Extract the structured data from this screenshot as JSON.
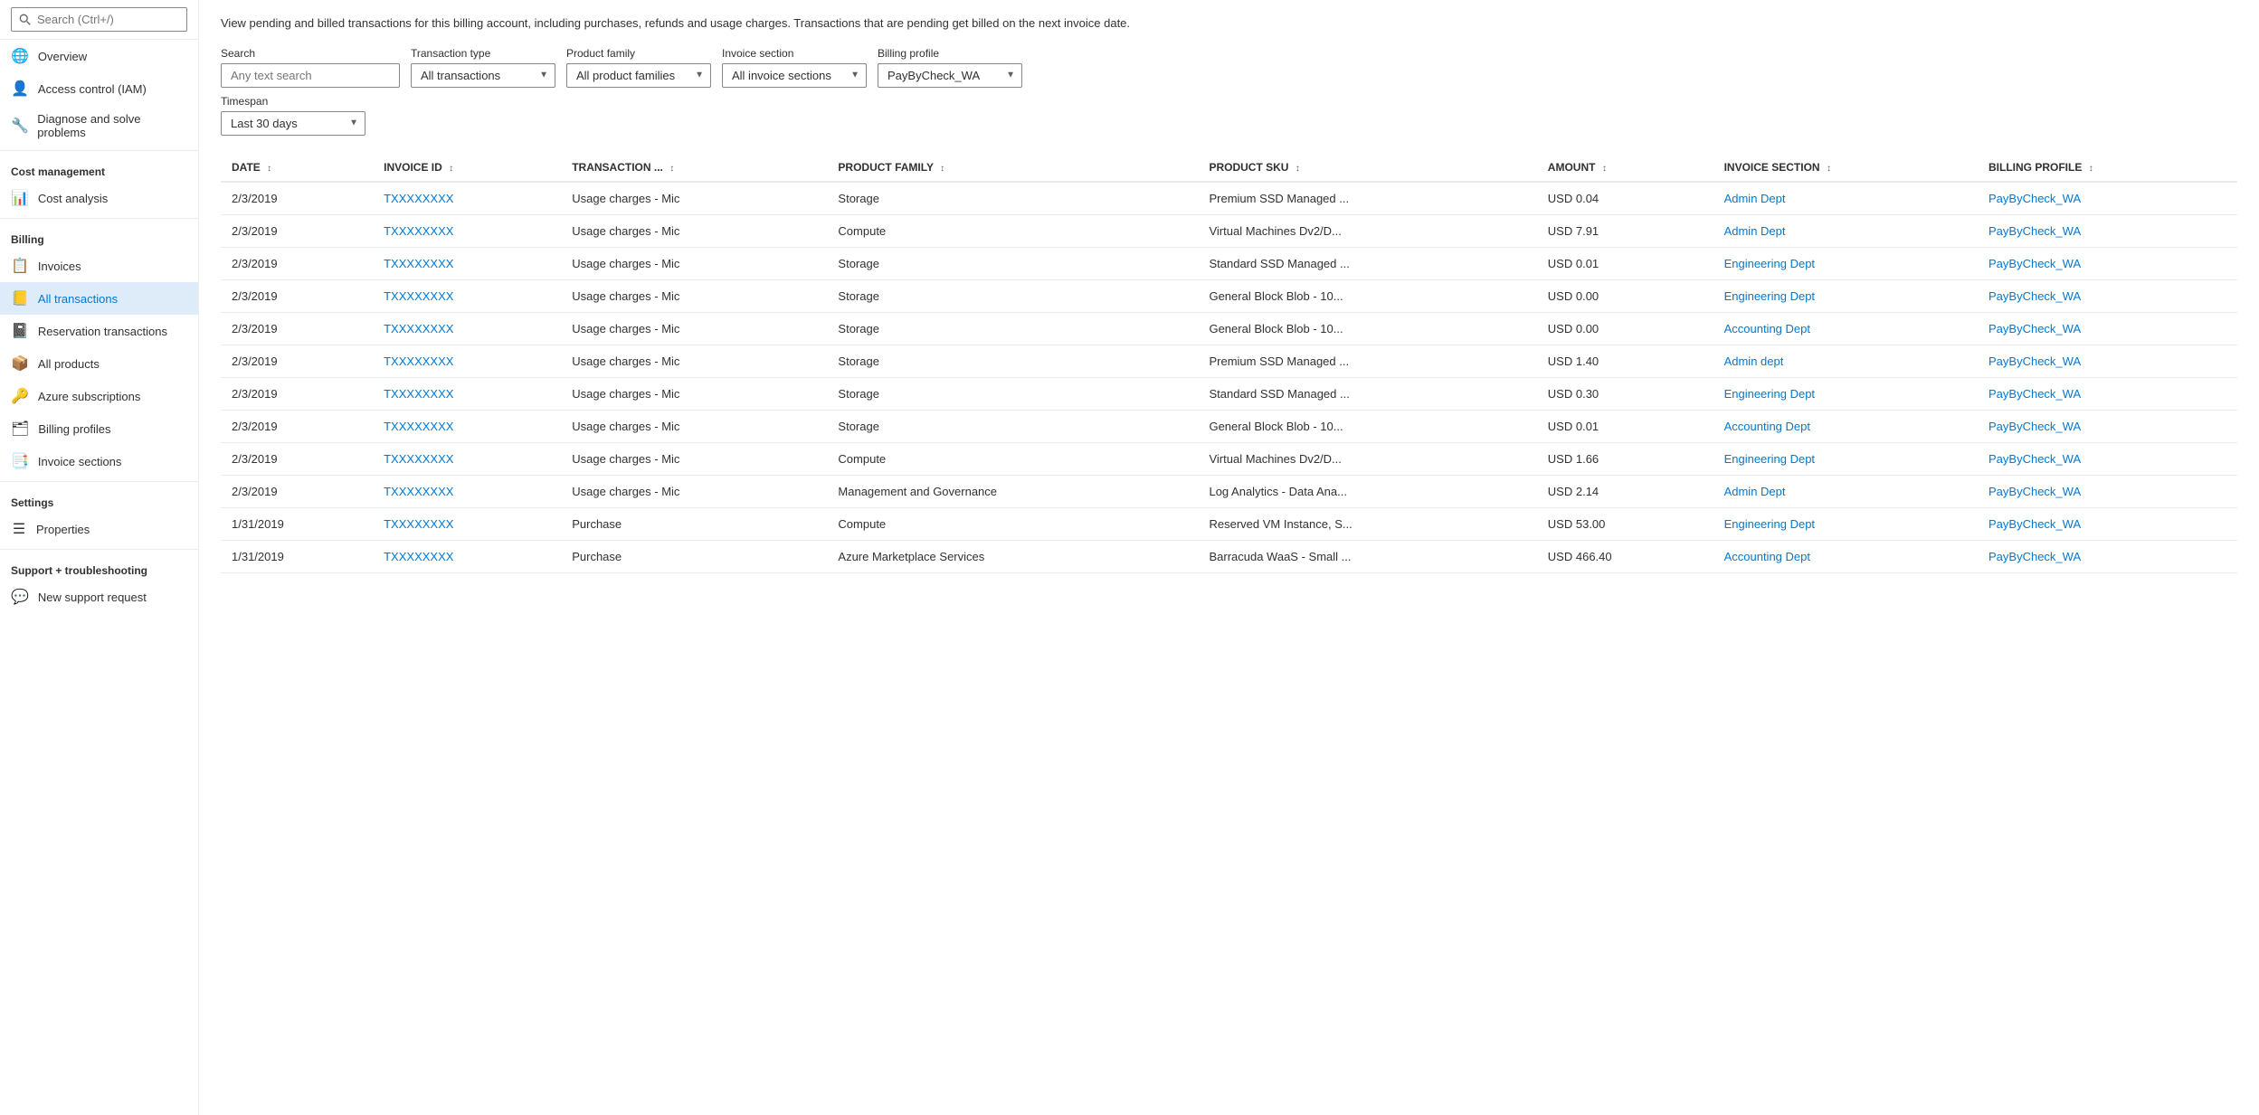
{
  "sidebar": {
    "search_placeholder": "Search (Ctrl+/)",
    "items": [
      {
        "id": "overview",
        "label": "Overview",
        "icon": "🌐",
        "section": null
      },
      {
        "id": "iam",
        "label": "Access control (IAM)",
        "icon": "👤",
        "section": null
      },
      {
        "id": "diagnose",
        "label": "Diagnose and solve problems",
        "icon": "🔧",
        "section": null
      },
      {
        "id": "cost-management-label",
        "label": "Cost management",
        "section_header": true
      },
      {
        "id": "cost-analysis",
        "label": "Cost analysis",
        "icon": "📊",
        "section": "cost-management"
      },
      {
        "id": "billing-label",
        "label": "Billing",
        "section_header": true
      },
      {
        "id": "invoices",
        "label": "Invoices",
        "icon": "📋",
        "section": "billing"
      },
      {
        "id": "all-transactions",
        "label": "All transactions",
        "icon": "📒",
        "section": "billing",
        "active": true
      },
      {
        "id": "reservation-transactions",
        "label": "Reservation transactions",
        "icon": "📓",
        "section": "billing"
      },
      {
        "id": "all-products",
        "label": "All products",
        "icon": "📦",
        "section": "billing"
      },
      {
        "id": "azure-subscriptions",
        "label": "Azure subscriptions",
        "icon": "🔑",
        "section": "billing"
      },
      {
        "id": "billing-profiles",
        "label": "Billing profiles",
        "icon": "🗂",
        "section": "billing"
      },
      {
        "id": "invoice-sections",
        "label": "Invoice sections",
        "icon": "📑",
        "section": "billing"
      },
      {
        "id": "settings-label",
        "label": "Settings",
        "section_header": true
      },
      {
        "id": "properties",
        "label": "Properties",
        "icon": "☰",
        "section": "settings"
      },
      {
        "id": "support-label",
        "label": "Support + troubleshooting",
        "section_header": true
      },
      {
        "id": "new-support-request",
        "label": "New support request",
        "icon": "💬",
        "section": "support"
      }
    ]
  },
  "page": {
    "description": "View pending and billed transactions for this billing account, including purchases, refunds and usage charges. Transactions that are pending get billed on the next invoice date."
  },
  "filters": {
    "search_label": "Search",
    "search_placeholder": "Any text search",
    "transaction_type_label": "Transaction type",
    "transaction_type_value": "All transactions",
    "product_family_label": "Product family",
    "product_family_value": "All product families",
    "invoice_section_label": "Invoice section",
    "invoice_section_value": "All invoice sections",
    "billing_profile_label": "Billing profile",
    "billing_profile_value": "PayByCheck_WA",
    "timespan_label": "Timespan",
    "timespan_value": "Last 30 days"
  },
  "table": {
    "columns": [
      {
        "id": "date",
        "label": "DATE"
      },
      {
        "id": "invoice-id",
        "label": "INVOICE ID"
      },
      {
        "id": "transaction",
        "label": "TRANSACTION ..."
      },
      {
        "id": "product-family",
        "label": "PRODUCT FAMILY"
      },
      {
        "id": "product-sku",
        "label": "PRODUCT SKU"
      },
      {
        "id": "amount",
        "label": "AMOUNT"
      },
      {
        "id": "invoice-section",
        "label": "INVOICE SECTION"
      },
      {
        "id": "billing-profile",
        "label": "BILLING PROFILE"
      }
    ],
    "rows": [
      {
        "date": "2/3/2019",
        "invoiceId": "TXXXXXXXX",
        "transaction": "Usage charges - Mic",
        "productFamily": "Storage",
        "productSku": "Premium SSD Managed ...",
        "amount": "USD 0.04",
        "invoiceSection": "Admin Dept",
        "billingProfile": "PayByCheck_WA"
      },
      {
        "date": "2/3/2019",
        "invoiceId": "TXXXXXXXX",
        "transaction": "Usage charges - Mic",
        "productFamily": "Compute",
        "productSku": "Virtual Machines Dv2/D...",
        "amount": "USD 7.91",
        "invoiceSection": "Admin Dept",
        "billingProfile": "PayByCheck_WA"
      },
      {
        "date": "2/3/2019",
        "invoiceId": "TXXXXXXXX",
        "transaction": "Usage charges - Mic",
        "productFamily": "Storage",
        "productSku": "Standard SSD Managed ...",
        "amount": "USD 0.01",
        "invoiceSection": "Engineering Dept",
        "billingProfile": "PayByCheck_WA"
      },
      {
        "date": "2/3/2019",
        "invoiceId": "TXXXXXXXX",
        "transaction": "Usage charges - Mic",
        "productFamily": "Storage",
        "productSku": "General Block Blob - 10...",
        "amount": "USD 0.00",
        "invoiceSection": "Engineering Dept",
        "billingProfile": "PayByCheck_WA"
      },
      {
        "date": "2/3/2019",
        "invoiceId": "TXXXXXXXX",
        "transaction": "Usage charges - Mic",
        "productFamily": "Storage",
        "productSku": "General Block Blob - 10...",
        "amount": "USD 0.00",
        "invoiceSection": "Accounting Dept",
        "billingProfile": "PayByCheck_WA"
      },
      {
        "date": "2/3/2019",
        "invoiceId": "TXXXXXXXX",
        "transaction": "Usage charges - Mic",
        "productFamily": "Storage",
        "productSku": "Premium SSD Managed ...",
        "amount": "USD 1.40",
        "invoiceSection": "Admin dept",
        "billingProfile": "PayByCheck_WA"
      },
      {
        "date": "2/3/2019",
        "invoiceId": "TXXXXXXXX",
        "transaction": "Usage charges - Mic",
        "productFamily": "Storage",
        "productSku": "Standard SSD Managed ...",
        "amount": "USD 0.30",
        "invoiceSection": "Engineering Dept",
        "billingProfile": "PayByCheck_WA"
      },
      {
        "date": "2/3/2019",
        "invoiceId": "TXXXXXXXX",
        "transaction": "Usage charges - Mic",
        "productFamily": "Storage",
        "productSku": "General Block Blob - 10...",
        "amount": "USD 0.01",
        "invoiceSection": "Accounting Dept",
        "billingProfile": "PayByCheck_WA"
      },
      {
        "date": "2/3/2019",
        "invoiceId": "TXXXXXXXX",
        "transaction": "Usage charges - Mic",
        "productFamily": "Compute",
        "productSku": "Virtual Machines Dv2/D...",
        "amount": "USD 1.66",
        "invoiceSection": "Engineering Dept",
        "billingProfile": "PayByCheck_WA"
      },
      {
        "date": "2/3/2019",
        "invoiceId": "TXXXXXXXX",
        "transaction": "Usage charges - Mic",
        "productFamily": "Management and Governance",
        "productSku": "Log Analytics - Data Ana...",
        "amount": "USD 2.14",
        "invoiceSection": "Admin Dept",
        "billingProfile": "PayByCheck_WA"
      },
      {
        "date": "1/31/2019",
        "invoiceId": "TXXXXXXXX",
        "transaction": "Purchase",
        "productFamily": "Compute",
        "productSku": "Reserved VM Instance, S...",
        "amount": "USD 53.00",
        "invoiceSection": "Engineering Dept",
        "billingProfile": "PayByCheck_WA"
      },
      {
        "date": "1/31/2019",
        "invoiceId": "TXXXXXXXX",
        "transaction": "Purchase",
        "productFamily": "Azure Marketplace Services",
        "productSku": "Barracuda WaaS - Small ...",
        "amount": "USD 466.40",
        "invoiceSection": "Accounting Dept",
        "billingProfile": "PayByCheck_WA"
      }
    ]
  }
}
